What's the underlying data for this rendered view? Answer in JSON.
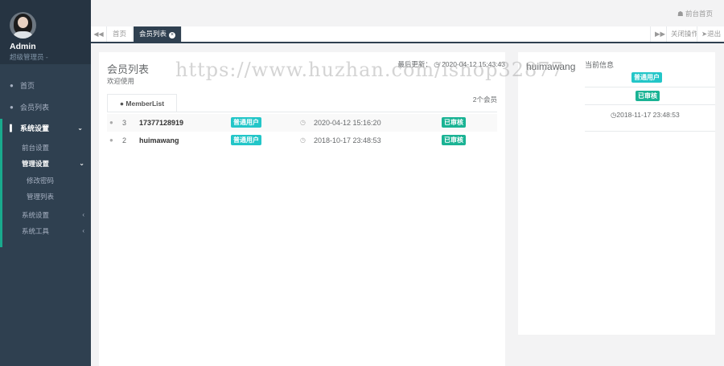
{
  "sidebar": {
    "admin_name": "Admin",
    "admin_role": "超级管理员 -",
    "items": [
      {
        "label": "首页",
        "icon": "user-icon"
      },
      {
        "label": "会员列表",
        "icon": "user-icon"
      },
      {
        "label": "系统设置",
        "icon": "cutlery-icon"
      }
    ],
    "sub_items": [
      {
        "label": "前台设置"
      },
      {
        "label": "管理设置"
      },
      {
        "label": "系统设置"
      },
      {
        "label": "系统工具"
      }
    ],
    "sub_sub_items": [
      {
        "label": "修改密码"
      },
      {
        "label": "管理列表"
      }
    ]
  },
  "topbar": {
    "home_link": "前台首页"
  },
  "tabbar": {
    "tabs": [
      {
        "label": "首页"
      },
      {
        "label": "会员列表"
      }
    ],
    "close_label": "关闭操作",
    "logout_label": "退出"
  },
  "main": {
    "title": "会员列表",
    "subtitle": "欢迎使用",
    "last_update": "最后更新：",
    "last_update_time": "2020-04-12 15:43:43",
    "tab_label": "MemberList",
    "member_count": "2个会员",
    "rows": [
      {
        "num": "3",
        "name": "17377128919",
        "type": "普通用户",
        "date": "2020-04-12 15:16:20",
        "status": "已审核"
      },
      {
        "num": "2",
        "name": "huimawang",
        "type": "普通用户",
        "date": "2018-10-17 23:48:53",
        "status": "已审核"
      }
    ]
  },
  "right": {
    "name": "huimawang",
    "title": "当前信息",
    "type": "普通用户",
    "status": "已审核",
    "date": "2018-11-17 23:48:53"
  },
  "watermark": "https://www.huzhan.com/ishop32877",
  "colors": {
    "sidebar": "#2f4050",
    "accent": "#1ab394",
    "info": "#23c6c8"
  }
}
